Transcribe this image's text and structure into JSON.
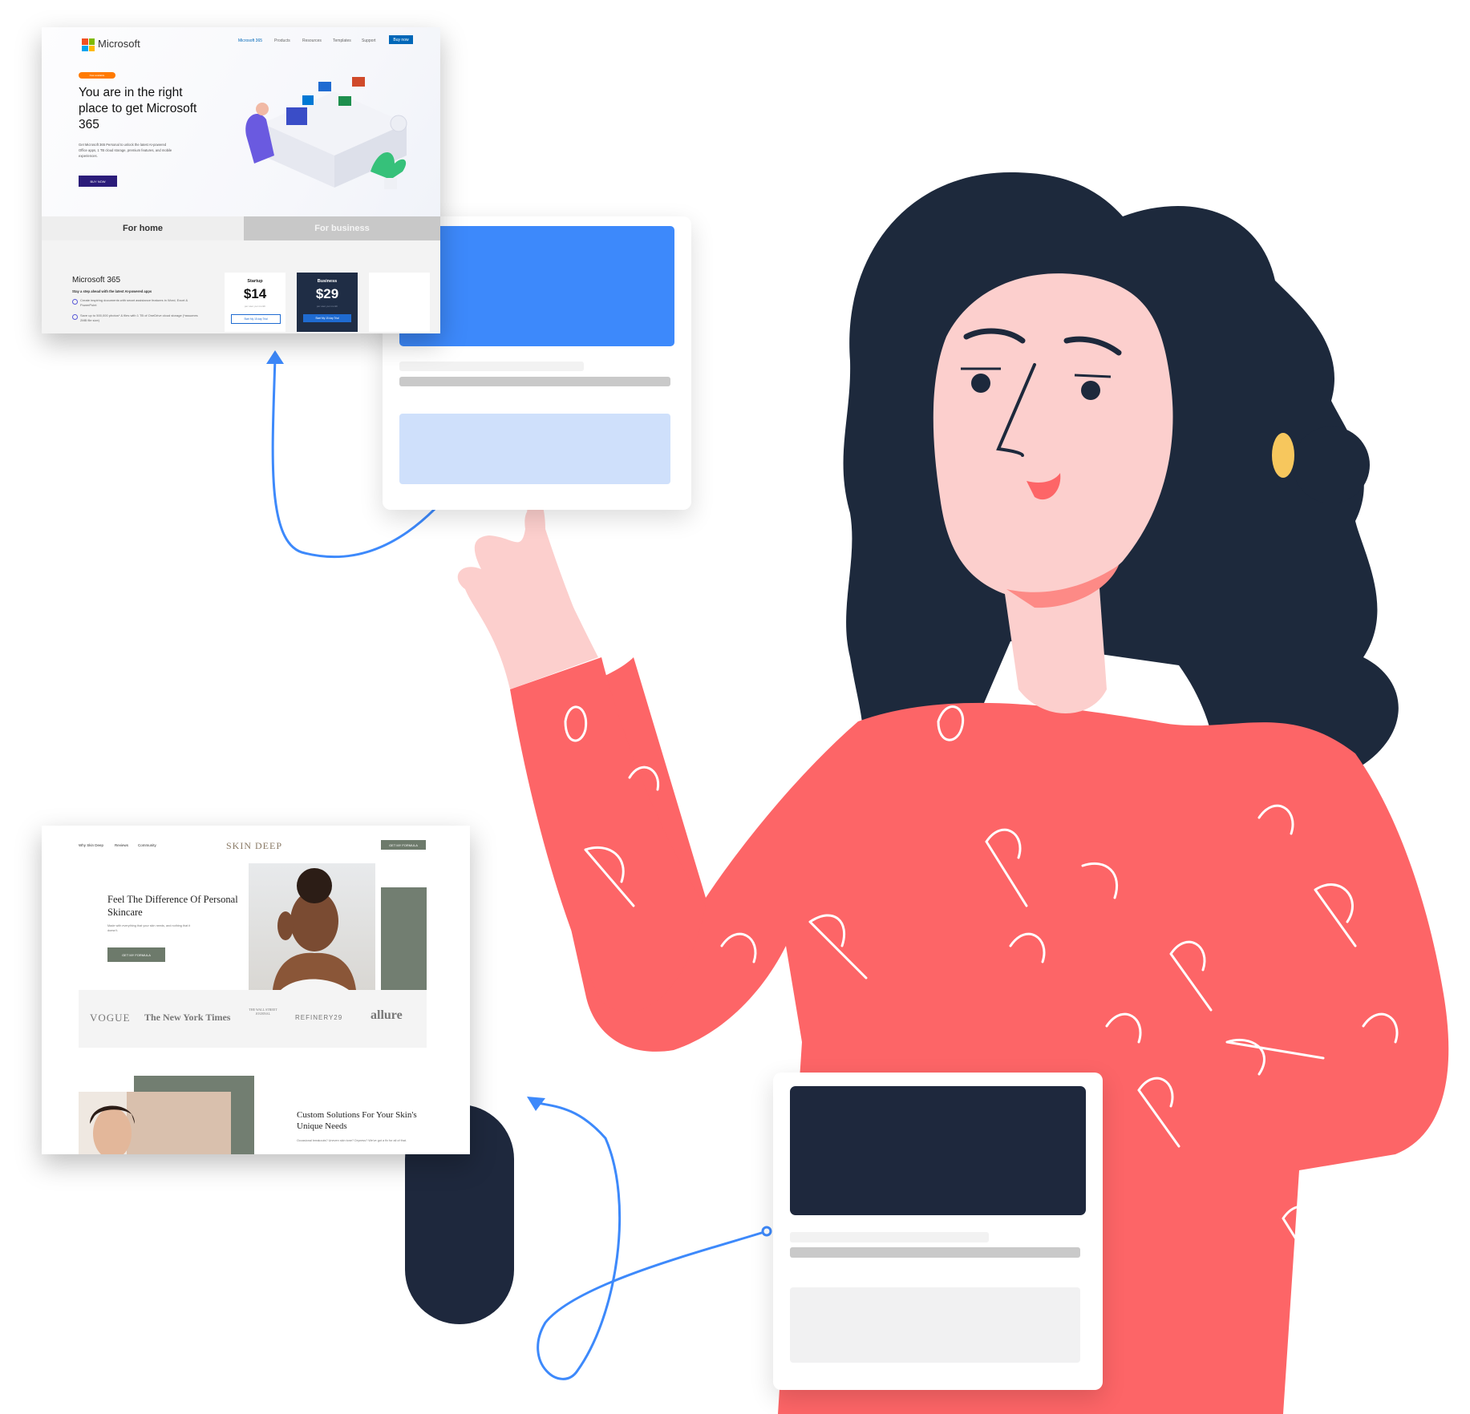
{
  "colors": {
    "accent_blue": "#3d89fb",
    "light_blue": "#cfe0fb",
    "navy": "#1e283d",
    "coral": "#fd6567",
    "skin": "#fccfcd",
    "hair": "#1d293c",
    "sage": "#727e71",
    "ms_blue": "#0067b8"
  },
  "microsoft_page": {
    "brand": "Microsoft",
    "nav": [
      "Microsoft 365",
      "Products",
      "Resources",
      "Templates",
      "Support"
    ],
    "nav_button": "Buy now",
    "hero_tag": "Now available",
    "hero_title": "You are in the right place to get Microsoft 365",
    "hero_body": "Get Microsoft 365 Personal to unlock the latest AI-powered Office apps, 1 TB cloud storage, premium features, and mobile experiences.",
    "hero_button": "BUY NOW",
    "tabs": [
      "For home",
      "For business"
    ],
    "product_title": "Microsoft 365",
    "product_subtitle": "Stay a step ahead with the latest AI-powered apps",
    "bullets": [
      "Create inspiring documents with smart assistance features in Word, Excel & PowerPoint",
      "Save up to 500,000 photos* & files with 1 TB of OneDrive cloud storage (*assumes 2MB file size)"
    ],
    "plans": [
      {
        "name": "Startup",
        "price": "$14",
        "note": "per user, per month",
        "button": "Start My 15 day Trial"
      },
      {
        "name": "Business",
        "price": "$29",
        "note": "per user, per month",
        "button": "Start My 15 day Trial"
      }
    ]
  },
  "skindeep_page": {
    "nav": [
      "Why Skin Deep",
      "Reviews",
      "Community"
    ],
    "logo": "SKIN DEEP",
    "nav_button": "GET MY FORMULA",
    "hero_title": "Feel The Difference Of Personal Skincare",
    "hero_body": "Made with everything that your skin needs, and nothing that it doesn't.",
    "hero_button": "GET MY FORMULA",
    "press": [
      "VOGUE",
      "The New York Times",
      "THE WALL STREET JOURNAL",
      "REFINERY29",
      "allure"
    ],
    "section_title": "Custom Solutions For Your Skin's Unique Needs",
    "section_body": "Occasional breakouts? Uneven skin tone? Dryness? We've got a fix for all of that."
  }
}
